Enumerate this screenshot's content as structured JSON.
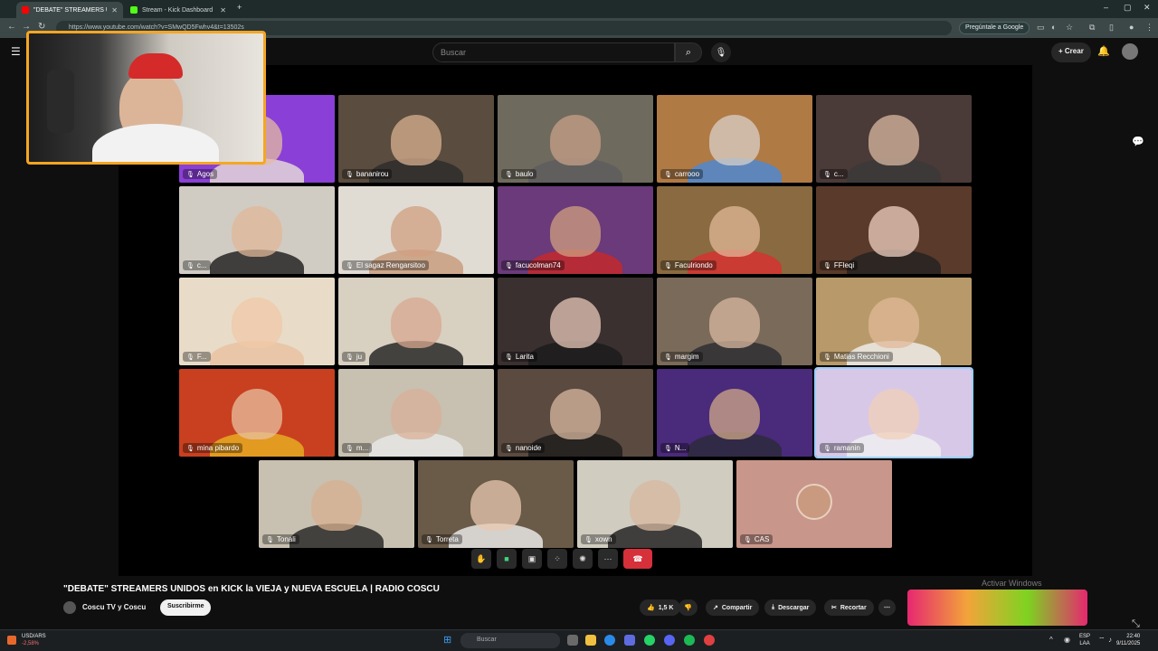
{
  "browser": {
    "tabs": [
      {
        "label": "\"DEBATE\" STREAMERS UNIDOS",
        "favicon_color": "#ff0000"
      },
      {
        "label": "Stream - Kick Dashboard",
        "favicon_color": "#53fc18"
      }
    ],
    "url": "https://www.youtube.com/watch?v=SMwQD5Fwhv4&t=13502s",
    "ask_google": "Pregúntale a Google"
  },
  "youtube": {
    "search_placeholder": "Buscar",
    "create_label": "Crear"
  },
  "participants": [
    {
      "name": "Agos",
      "bg": "#8a3fd6",
      "skin": "#e3bca0",
      "shirt": "#e8e0d8"
    },
    {
      "name": "bananirou",
      "bg": "#5a4c3e",
      "skin": "#d8b090",
      "shirt": "#2a2a2a"
    },
    {
      "name": "baulo",
      "bg": "#6f6a5e",
      "skin": "#c7a088",
      "shirt": "#5c5c5c"
    },
    {
      "name": "carrooo",
      "bg": "#b07a45",
      "skin": "#d8d0c8",
      "shirt": "#4a8ad8"
    },
    {
      "name": "c...",
      "bg": "#4a3a38",
      "skin": "#d9b8a0",
      "shirt": "#3a3a3a"
    },
    {
      "name": "c...",
      "bg": "#d0ccc4",
      "skin": "#e0b89a",
      "shirt": "#1a1a1a"
    },
    {
      "name": "El sagaz Rengarsitoo",
      "bg": "#e0dcd4",
      "skin": "#d0a080",
      "shirt": "#c89a78"
    },
    {
      "name": "facucolman74",
      "bg": "#6a3a7a",
      "skin": "#d0a080",
      "shirt": "#c82828"
    },
    {
      "name": "Faculriondo",
      "bg": "#8a6a40",
      "skin": "#e0b898",
      "shirt": "#d83030"
    },
    {
      "name": "FFleqi",
      "bg": "#5a3a2a",
      "skin": "#f0d0c0",
      "shirt": "#222"
    },
    {
      "name": "F...",
      "bg": "#e8dcc8",
      "skin": "#f0c8a8",
      "shirt": "#e8c0a0"
    },
    {
      "name": "ju",
      "bg": "#d8d0c0",
      "skin": "#d8a890",
      "shirt": "#1e1e1e"
    },
    {
      "name": "Larita",
      "bg": "#3a3030",
      "skin": "#e8c8b8",
      "shirt": "#1a1a1a"
    },
    {
      "name": "margim",
      "bg": "#7a6a5a",
      "skin": "#d8b8a0",
      "shirt": "#2a2a30"
    },
    {
      "name": "Matias Recchioni",
      "bg": "#b89a6a",
      "skin": "#e0b898",
      "shirt": "#f0f0f0"
    },
    {
      "name": "mina pibardo",
      "bg": "#c84020",
      "skin": "#e8c0a0",
      "shirt": "#e8b020"
    },
    {
      "name": "m...",
      "bg": "#c8c0b0",
      "skin": "#d8b098",
      "shirt": "#e8e8e8"
    },
    {
      "name": "nanoide",
      "bg": "#5a4a40",
      "skin": "#d8b8a0",
      "shirt": "#1a1a1a"
    },
    {
      "name": "N...",
      "bg": "#4a2a7a",
      "skin": "#d0a888",
      "shirt": "#2a2a3a"
    },
    {
      "name": "ramanin",
      "bg": "#d8c8e8",
      "skin": "#f0d0b8",
      "shirt": "#f0f0f0"
    },
    {
      "name": "Tonali",
      "bg": "#c8c0b0",
      "skin": "#d8b090",
      "shirt": "#202020"
    },
    {
      "name": "Torreta",
      "bg": "#6a5a48",
      "skin": "#e8c8b0",
      "shirt": "#f0f0f0"
    },
    {
      "name": "xown",
      "bg": "#d0ccc0",
      "skin": "#d8b8a0",
      "shirt": "#1a1a1a"
    },
    {
      "name": "CAS",
      "bg": "#c8968a",
      "skin": "#c99a80",
      "shirt": "#c8968a"
    }
  ],
  "video": {
    "title": "\"DEBATE\" STREAMERS UNIDOS en KICK la VIEJA y NUEVA ESCUELA | RADIO COSCU",
    "channel": "Coscu TV y Coscu",
    "subscribe": "Suscribirme",
    "likes": "1,5 K",
    "share": "Compartir",
    "download": "Descargar",
    "clip": "Recortar",
    "watermark": "Activar Windows"
  },
  "taskbar": {
    "stock_name": "USD/ARS",
    "stock_change": "-2,58%",
    "search": "Buscar",
    "lang1": "ESP",
    "lang2": "LAA",
    "time": "22:40",
    "date": "9/11/2025"
  },
  "colors": {
    "webcam_border": "#f5a623",
    "hangup": "#d6303a",
    "active_speaker": "#9ad0ff"
  }
}
